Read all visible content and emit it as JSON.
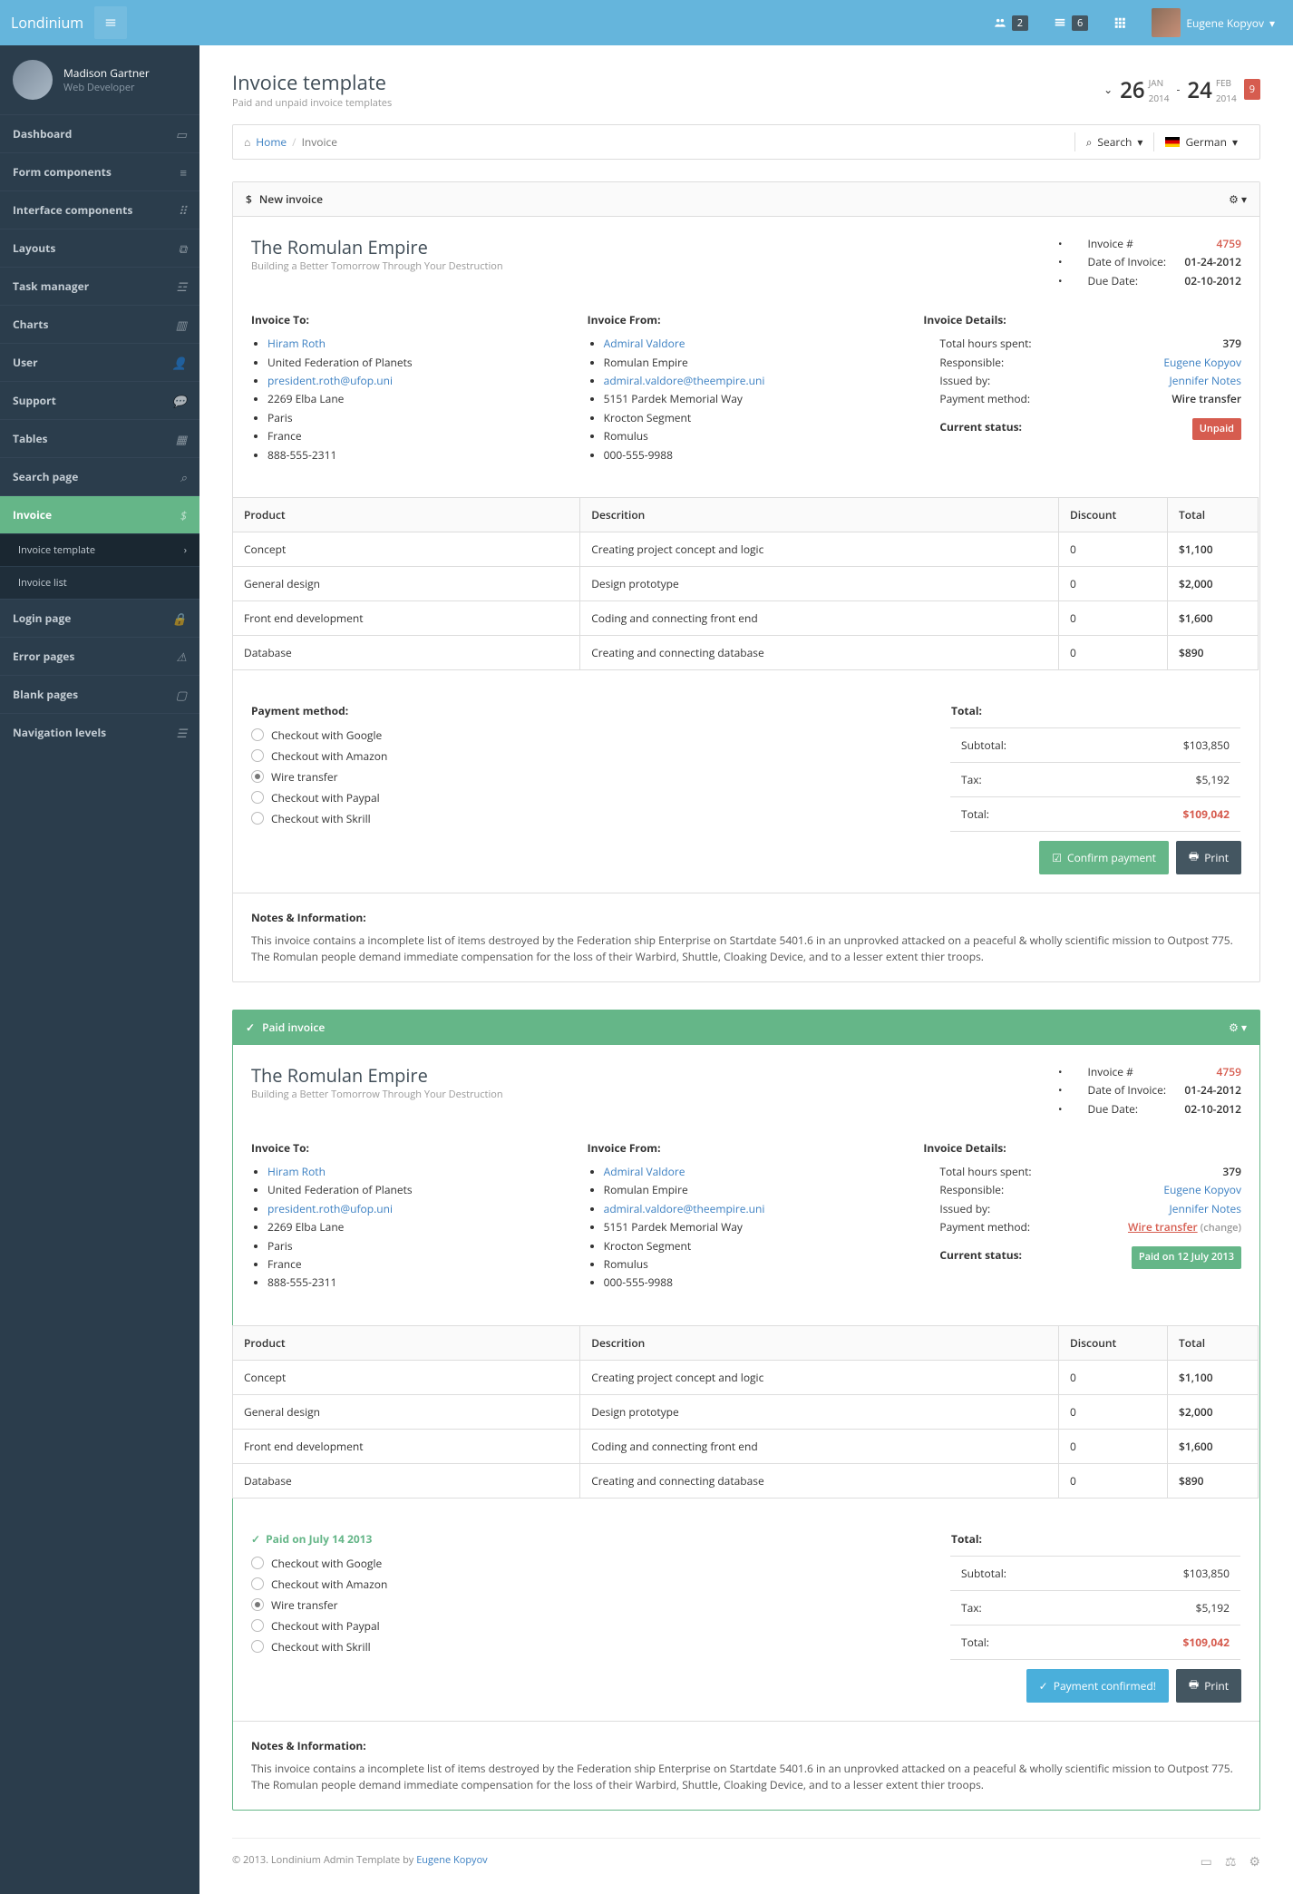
{
  "topbar": {
    "brand": "Londinium",
    "badge1": "2",
    "badge2": "6",
    "user": "Eugene Kopyov"
  },
  "sidebar": {
    "user": {
      "name": "Madison Gartner",
      "role": "Web Developer"
    },
    "items": [
      "Dashboard",
      "Form components",
      "Interface components",
      "Layouts",
      "Task manager",
      "Charts",
      "User",
      "Support",
      "Tables",
      "Search page",
      "Invoice",
      "Login page",
      "Error pages",
      "Blank pages",
      "Navigation levels"
    ],
    "sub": [
      "Invoice template",
      "Invoice list"
    ]
  },
  "page": {
    "title": "Invoice template",
    "sub": "Paid and unpaid invoice templates",
    "date1": {
      "d": "26",
      "m": "JAN",
      "y": "2014"
    },
    "date2": {
      "d": "24",
      "m": "FEB",
      "y": "2014"
    },
    "badge": "9"
  },
  "bc": {
    "home": "Home",
    "current": "Invoice",
    "search": "Search",
    "lang": "German"
  },
  "inv": {
    "newTitle": "New invoice",
    "paidTitle": "Paid invoice",
    "company": "The Romulan Empire",
    "tag": "Building a Better Tomorrow Through Your Destruction",
    "meta": {
      "num": "4759",
      "date": "01-24-2012",
      "due": "02-10-2012",
      "lbl_num": "Invoice #",
      "lbl_date": "Date of Invoice:",
      "lbl_due": "Due Date:"
    },
    "to": {
      "h": "Invoice To:",
      "name": "Hiram Roth",
      "org": "United Federation of Planets",
      "email": "president.roth@ufop.uni",
      "addr": "2269 Elba Lane",
      "city": "Paris",
      "country": "France",
      "phone": "888-555-2311"
    },
    "from": {
      "h": "Invoice From:",
      "name": "Admiral Valdore",
      "org": "Romulan Empire",
      "email": "admiral.valdore@theempire.uni",
      "addr": "5151 Pardek Memorial Way",
      "city": "Krocton Segment",
      "country": "Romulus",
      "phone": "000-555-9988"
    },
    "details": {
      "h": "Invoice Details:",
      "hours": "379",
      "resp": "Eugene Kopyov",
      "issued": "Jennifer Notes",
      "method": "Wire transfer",
      "status": "Current status:",
      "unpaid": "Unpaid",
      "paid": "Paid on 12 July 2013",
      "change": "(change)",
      "lbl_hours": "Total hours spent:",
      "lbl_resp": "Responsible:",
      "lbl_issued": "Issued by:",
      "lbl_method": "Payment method:"
    },
    "th": [
      "Product",
      "Descrition",
      "Discount",
      "Total"
    ],
    "rows": [
      [
        "Concept",
        "Creating project concept and logic",
        "0",
        "$1,100"
      ],
      [
        "General design",
        "Design prototype",
        "0",
        "$2,000"
      ],
      [
        "Front end development",
        "Coding and connecting front end",
        "0",
        "$1,600"
      ],
      [
        "Database",
        "Creating and connecting database",
        "0",
        "$890"
      ]
    ],
    "pay": {
      "h": "Payment method:",
      "paidh": "Paid on July 14 2013",
      "opts": [
        "Checkout with Google",
        "Checkout with Amazon",
        "Wire transfer",
        "Checkout with Paypal",
        "Checkout with Skrill"
      ]
    },
    "tot": {
      "h": "Total:",
      "sub": "Subtotal:",
      "subv": "$103,850",
      "tax": "Tax:",
      "taxv": "$5,192",
      "total": "Total:",
      "totalv": "$109,042"
    },
    "btn": {
      "confirm": "Confirm payment",
      "print": "Print",
      "confirmed": "Payment confirmed!"
    },
    "notes": {
      "h": "Notes & Information:",
      "p": "This invoice contains a incomplete list of items destroyed by the Federation ship Enterprise on Startdate 5401.6 in an unprovked attacked on a peaceful & wholly scientific mission to Outpost 775. The Romulan people demand immediate compensation for the loss of their Warbird, Shuttle, Cloaking Device, and to a lesser extent thier troops."
    }
  },
  "footer": {
    "text": "© 2013. Londinium Admin Template by ",
    "author": "Eugene Kopyov"
  }
}
